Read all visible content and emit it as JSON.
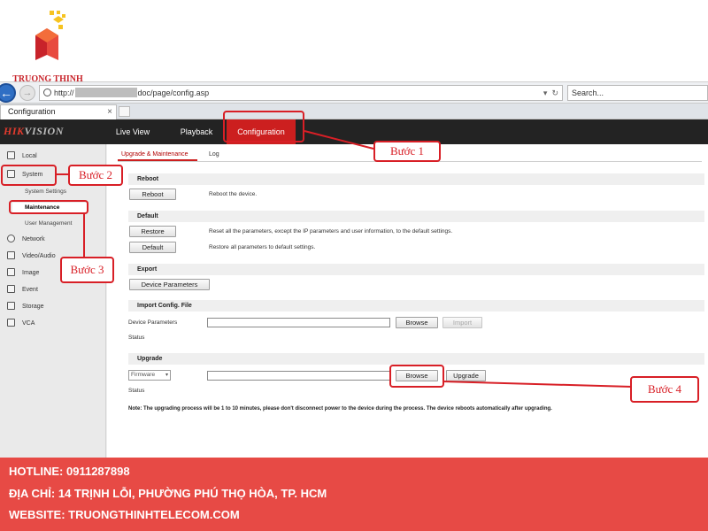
{
  "brand": {
    "name": "TRUONG THINH"
  },
  "browser": {
    "url_suffix": "doc/page/config.asp",
    "url_prefix": "http://",
    "search_placeholder": "Search...",
    "tab_title": "Configuration",
    "tab_close": "×",
    "back_icon": "arrow-left-icon",
    "dropdown_glyph": "▾",
    "refresh_glyph": "↻"
  },
  "header": {
    "logo_main": "HIK",
    "logo_rest": "VISION",
    "nav": {
      "live": "Live View",
      "playback": "Playback",
      "config": "Configuration"
    }
  },
  "sidebar": {
    "items": [
      {
        "label": "Local",
        "icon": "monitor-icon"
      },
      {
        "label": "System",
        "icon": "system-icon"
      },
      {
        "label": "Network",
        "icon": "globe-icon"
      },
      {
        "label": "Video/Audio",
        "icon": "video-icon"
      },
      {
        "label": "Image",
        "icon": "image-icon"
      },
      {
        "label": "Event",
        "icon": "event-icon"
      },
      {
        "label": "Storage",
        "icon": "storage-icon"
      },
      {
        "label": "VCA",
        "icon": "vca-icon"
      }
    ],
    "sub": {
      "settings": "System Settings",
      "maintenance": "Maintenance",
      "users": "User Management"
    }
  },
  "main": {
    "tabs": {
      "upgrade": "Upgrade & Maintenance",
      "log": "Log"
    },
    "reboot": {
      "title": "Reboot",
      "button": "Reboot",
      "desc": "Reboot the device."
    },
    "default": {
      "title": "Default",
      "restore_button": "Restore",
      "restore_desc": "Reset all the parameters, except the IP parameters and user information, to the default settings.",
      "default_button": "Default",
      "default_desc": "Restore all parameters to default settings."
    },
    "export": {
      "title": "Export",
      "button": "Device Parameters"
    },
    "import": {
      "title": "Import Config. File",
      "label": "Device Parameters",
      "browse": "Browse",
      "import": "Import",
      "status": "Status"
    },
    "upgrade": {
      "title": "Upgrade",
      "select": "Firmware",
      "browse": "Browse",
      "upgrade": "Upgrade",
      "status": "Status"
    },
    "note": "Note: The upgrading process will be 1 to 10 minutes, please don't disconnect power to the device during the process. The device reboots automatically after upgrading."
  },
  "annotations": {
    "step1": "Bước 1",
    "step2": "Bước 2",
    "step3": "Bước 3",
    "step4": "Bước 4"
  },
  "footer": {
    "hotline": "HOTLINE: 0911287898",
    "address": "ĐỊA CHỈ: 14 TRỊNH LỖI, PHƯỜNG PHÚ THỌ HÒA, TP. HCM",
    "website": "WEBSITE: TRUONGTHINHTELECOM.COM"
  },
  "colors": {
    "accent": "#d81f26",
    "footer": "#e74a45",
    "header": "#232323",
    "nav_active": "#cc1f1f"
  }
}
